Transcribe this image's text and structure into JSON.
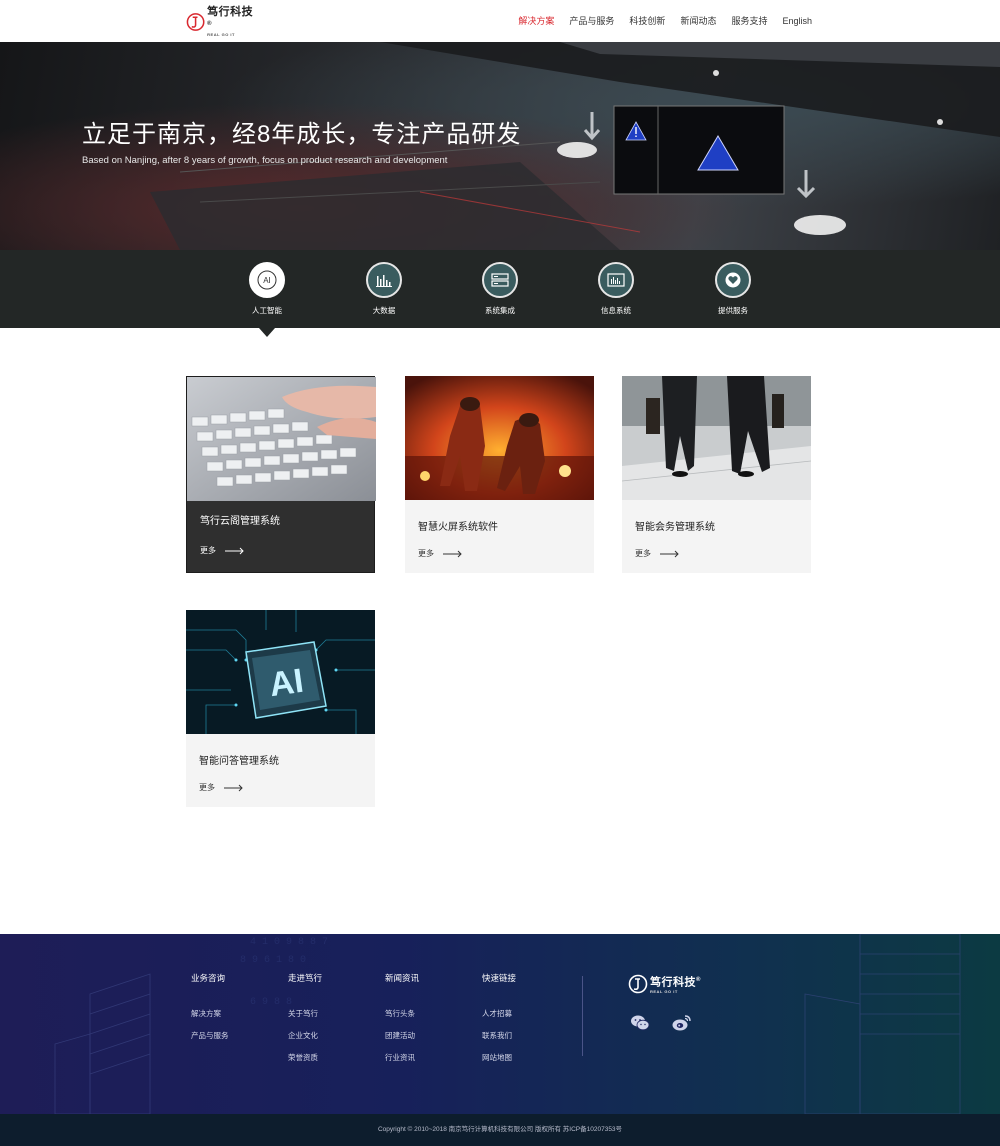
{
  "header": {
    "logo_name": "笃行科技",
    "logo_reg": "®",
    "logo_sub": "REAL GO IT",
    "nav": [
      {
        "label": "解决方案",
        "active": true
      },
      {
        "label": "产品与服务",
        "active": false
      },
      {
        "label": "科技创新",
        "active": false
      },
      {
        "label": "新闻动态",
        "active": false
      },
      {
        "label": "服务支持",
        "active": false
      },
      {
        "label": "English",
        "active": false
      }
    ]
  },
  "hero": {
    "title": "立足于南京，经8年成长，专注产品研发",
    "subtitle": "Based on Nanjing, after 8 years of growth, focus on product research and development"
  },
  "categories": [
    {
      "label": "人工智能",
      "icon": "ai-icon",
      "icon_text": "AI",
      "active": true
    },
    {
      "label": "大数据",
      "icon": "bar-chart-icon",
      "active": false
    },
    {
      "label": "系统集成",
      "icon": "server-icon",
      "active": false
    },
    {
      "label": "信息系统",
      "icon": "monitor-chart-icon",
      "active": false
    },
    {
      "label": "提供服务",
      "icon": "heart-icon",
      "active": false
    }
  ],
  "cards": [
    {
      "title": "笃行云阁管理系统",
      "more": "更多",
      "image": "keyboard-typing-photo",
      "highlighted": true
    },
    {
      "title": "智慧火屏系统软件",
      "more": "更多",
      "image": "firefighters-photo",
      "highlighted": false
    },
    {
      "title": "智能会务管理系统",
      "more": "更多",
      "image": "businessmen-walking-photo",
      "highlighted": false
    },
    {
      "title": "智能问答管理系统",
      "more": "更多",
      "image": "ai-chip-photo",
      "highlighted": false
    }
  ],
  "footer": {
    "columns": [
      {
        "title": "业务咨询",
        "links": [
          "解决方案",
          "产品与服务"
        ]
      },
      {
        "title": "走进笃行",
        "links": [
          "关于笃行",
          "企业文化",
          "荣誉资质"
        ]
      },
      {
        "title": "新闻资讯",
        "links": [
          "笃行头条",
          "团建活动",
          "行业资讯"
        ]
      },
      {
        "title": "快速链接",
        "links": [
          "人才招募",
          "联系我们",
          "网站地图"
        ]
      }
    ],
    "logo_name": "笃行科技",
    "logo_reg": "®",
    "logo_sub": "REAL GO IT",
    "social": [
      "wechat-icon",
      "weibo-icon"
    ],
    "copyright": "Copyright © 2010~2018 南京笃行计算机科技有限公司 版权所有 苏ICP备10207353号"
  },
  "colors": {
    "accent": "#d9282f",
    "category_bar": "#232726",
    "category_circle": "#3a5c5f",
    "card_bg": "#f4f4f4",
    "card_active_bg": "#2f2f2f"
  }
}
